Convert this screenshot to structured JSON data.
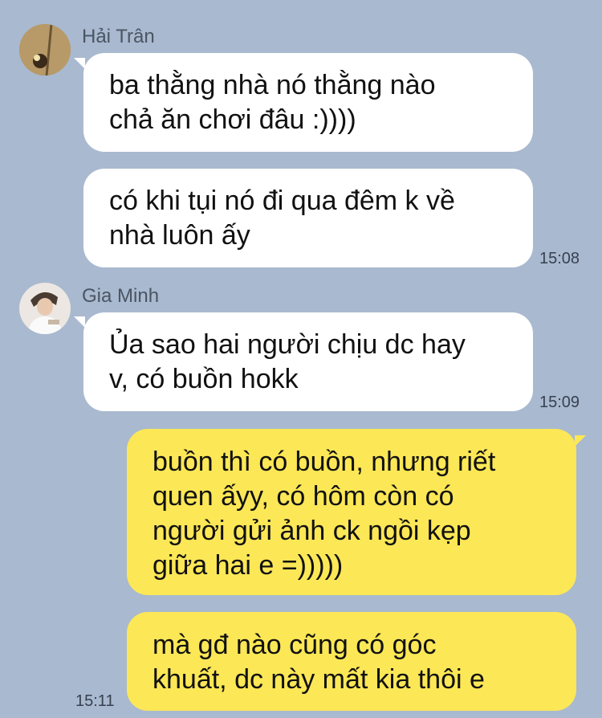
{
  "messages": [
    {
      "sender": "Hải Trân",
      "avatar": "hai-tran-avatar",
      "bubbles": [
        {
          "text": "ba thằng nhà nó thằng nào\nchả ăn chơi đâu :))))"
        },
        {
          "text": "có khi tụi nó đi qua đêm k về\nnhà luôn ấy",
          "time": "15:08"
        }
      ]
    },
    {
      "sender": "Gia Minh",
      "avatar": "gia-minh-avatar",
      "bubbles": [
        {
          "text": "Ủa sao hai người chịu dc hay\nv, có buồn hokk",
          "time": "15:09"
        }
      ]
    },
    {
      "sender": "me",
      "bubbles": [
        {
          "text": "buồn thì có buồn, nhưng riết\nquen ấyy, có hôm còn  có\nngười gửi ảnh ck ngồi kẹp\ngiữa hai e =)))))"
        },
        {
          "text": "mà gđ nào cũng có góc\nkhuất, dc này mất kia thôi e",
          "time": "15:11"
        }
      ]
    }
  ],
  "colors": {
    "background": "#a9b9cf",
    "incoming_bubble": "#ffffff",
    "outgoing_bubble": "#fce756"
  }
}
